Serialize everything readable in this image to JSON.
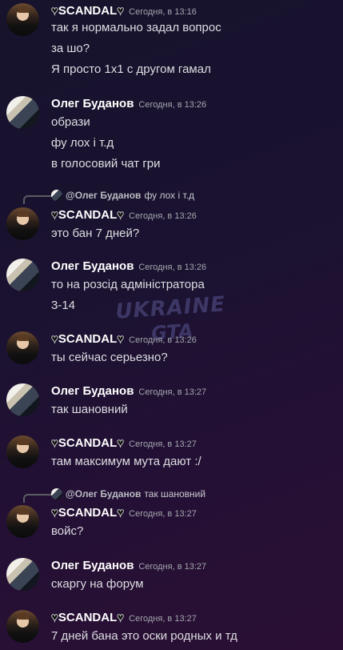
{
  "messages": [
    {
      "author": "SCANDAL",
      "time": "Сегодня, в 13:16",
      "lines": [
        "так я нормально задал вопрос",
        "за шо?",
        "Я просто 1х1 с другом гамал"
      ]
    },
    {
      "author": "Олег Буданов",
      "time": "Сегодня, в 13:26",
      "lines": [
        "образи",
        "фу лох і т.д",
        "в голосовий чат гри"
      ]
    },
    {
      "reply_author": "@Олег Буданов",
      "reply_text": "фу лох і т.д",
      "author": "SCANDAL",
      "time": "Сегодня, в 13:26",
      "lines": [
        "это бан 7 дней?"
      ]
    },
    {
      "author": "Олег Буданов",
      "time": "Сегодня, в 13:26",
      "lines": [
        "то на розсід адміністратора",
        "3-14"
      ]
    },
    {
      "author": "SCANDAL",
      "time": "Сегодня, в 13:26",
      "lines": [
        "ты сейчас серьезно?"
      ]
    },
    {
      "author": "Олег Буданов",
      "time": "Сегодня, в 13:27",
      "lines": [
        "так шановний"
      ]
    },
    {
      "author": "SCANDAL",
      "time": "Сегодня, в 13:27",
      "lines": [
        "там максимум мута дают :/"
      ]
    },
    {
      "reply_author": "@Олег Буданов",
      "reply_text": "так шановний",
      "author": "SCANDAL",
      "time": "Сегодня, в 13:27",
      "lines": [
        "войс?"
      ]
    },
    {
      "author": "Олег Буданов",
      "time": "Сегодня, в 13:27",
      "lines": [
        "скаргу на форум"
      ]
    },
    {
      "author": "SCANDAL",
      "time": "Сегодня, в 13:27",
      "lines": [
        "7 дней бана это оски родных и тд"
      ]
    }
  ],
  "watermark": {
    "line1": "UKRAINE",
    "line2": "GTA"
  },
  "icons": {
    "heart": "♥"
  }
}
